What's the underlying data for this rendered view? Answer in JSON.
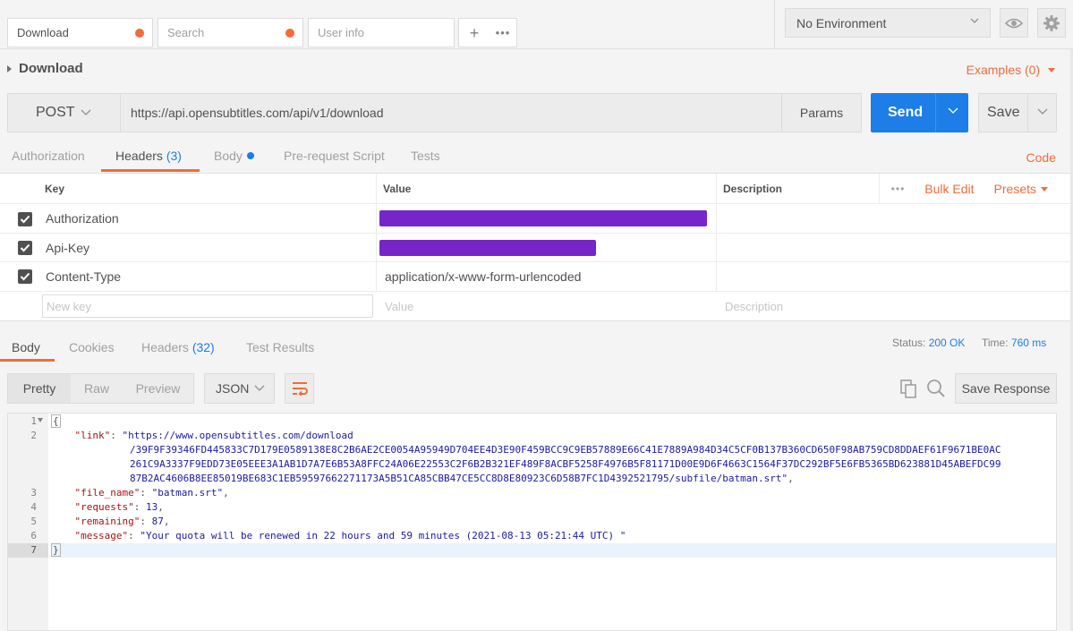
{
  "tabs": [
    {
      "label": "Download",
      "unsaved": true
    },
    {
      "label": "Search",
      "unsaved": true,
      "placeholder_style": true
    },
    {
      "label": "User info",
      "unsaved": false,
      "placeholder_style": true
    }
  ],
  "environment": {
    "selected": "No Environment"
  },
  "request": {
    "title": "Download",
    "examples_label": "Examples (0)",
    "method": "POST",
    "url": "https://api.opensubtitles.com/api/v1/download",
    "params_label": "Params",
    "send_label": "Send",
    "save_label": "Save"
  },
  "request_tabs": {
    "authorization": "Authorization",
    "headers": "Headers",
    "headers_count": "(3)",
    "body": "Body",
    "prerequest": "Pre-request Script",
    "tests": "Tests",
    "code": "Code"
  },
  "headers_table": {
    "col_key": "Key",
    "col_value": "Value",
    "col_description": "Description",
    "bulk_edit": "Bulk Edit",
    "presets": "Presets",
    "rows": [
      {
        "key": "Authorization",
        "value": "[redacted]",
        "checked": true
      },
      {
        "key": "Api-Key",
        "value": "[redacted]",
        "checked": true
      },
      {
        "key": "Content-Type",
        "value": "application/x-www-form-urlencoded",
        "checked": true
      }
    ],
    "new_key_placeholder": "New key",
    "value_placeholder": "Value",
    "description_placeholder": "Description"
  },
  "response_tabs": {
    "body": "Body",
    "cookies": "Cookies",
    "headers": "Headers",
    "headers_count": "(32)",
    "test_results": "Test Results"
  },
  "response_status": {
    "status_label": "Status:",
    "status_value": "200 OK",
    "time_label": "Time:",
    "time_value": "760 ms"
  },
  "response_toolbar": {
    "pretty": "Pretty",
    "raw": "Raw",
    "preview": "Preview",
    "format": "JSON",
    "save_response": "Save Response"
  },
  "response_body": {
    "line_numbers": [
      "1",
      "2",
      "3",
      "4",
      "5",
      "6",
      "7"
    ],
    "open_brace": "{",
    "close_brace": "}",
    "link_key": "\"link\"",
    "link_value_1": "\"https://www.opensubtitles.com/download",
    "link_value_2": "/39F9F39346FD445833C7D179E0589138E8C2B6AE2CE0054A95949D704EE4D3E90F459BCC9C9EB57889E66C41E7889A984D34C5CF0B137B360CD650F98AB759CD8DDAEF61F9671BE0AC",
    "link_value_3": "261C9A3337F9EDD73E05EEE3A1AB1D7A7E6B53A8FFC24A06E22553C2F6B2B321EF489F8ACBF5258F4976B5F81171D00E9D6F4663C1564F37DC292BF5E6FB5365BD623881D45ABEFDC99",
    "link_value_4": "87B2AC4606B8EE85019BE683C1EB59597662271173A5B51CA85CBB47CE5CC8D8E80923C6D58B7FC1D4392521795/subfile/batman.srt\"",
    "file_name_key": "\"file_name\"",
    "file_name_value": "\"batman.srt\"",
    "requests_key": "\"requests\"",
    "requests_value": "13",
    "remaining_key": "\"remaining\"",
    "remaining_value": "87",
    "message_key": "\"message\"",
    "message_value": "\"Your quota will be renewed in 22 hours and 59 minutes (2021-08-13 05:21:44 UTC) \""
  },
  "colors": {
    "accent_orange": "#f26b3a",
    "accent_blue": "#1c7ee6",
    "redaction_purple": "#6a12c4"
  },
  "icons": [
    "plus-icon",
    "more-icon",
    "chevron-down-icon",
    "eye-icon",
    "gear-icon",
    "checkbox-icon",
    "wrap-lines-icon",
    "copy-icon",
    "search-icon"
  ]
}
